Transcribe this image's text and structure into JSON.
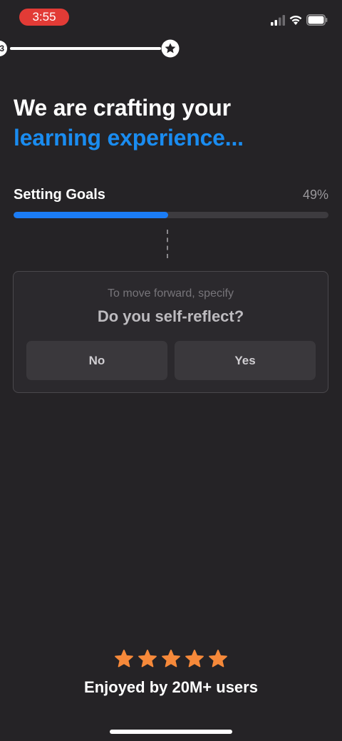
{
  "status_bar": {
    "time": "3:55",
    "time_pill_color": "#e23b36",
    "icons": [
      "signal-icon",
      "wifi-icon",
      "battery-icon"
    ]
  },
  "top_track": {
    "start_node_text": "3",
    "end_icon": "star-icon"
  },
  "headline": {
    "line1": "We are crafting your",
    "line2": "learning experience...",
    "accent_color": "#1a8cf0"
  },
  "progress": {
    "label": "Setting Goals",
    "percent_text": "49%",
    "value": 49,
    "fill_color": "#1b7cf5"
  },
  "question_card": {
    "hint": "To move forward, specify",
    "question": "Do you self-reflect?",
    "answers": {
      "no": "No",
      "yes": "Yes"
    }
  },
  "rating": {
    "stars": 5,
    "star_color": "#f6893a",
    "text": "Enjoyed by 20M+ users"
  }
}
